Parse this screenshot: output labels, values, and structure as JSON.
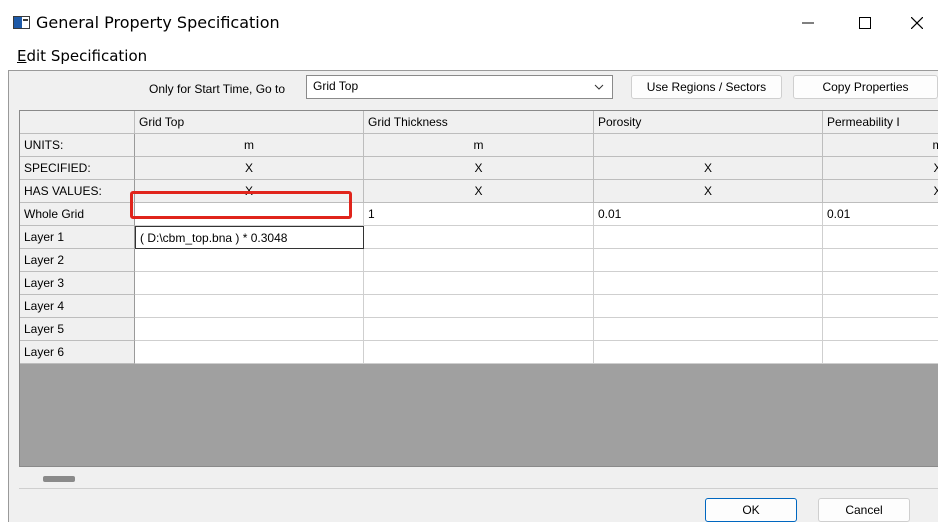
{
  "window": {
    "title": "General Property Specification",
    "minimize_glyph": "—",
    "close_glyph": "✕"
  },
  "menu": {
    "edit_first": "E",
    "edit_rest": "dit Specification"
  },
  "toolbar": {
    "goto_label": "Only for Start Time, Go to",
    "goto_selected": "Grid Top",
    "use_regions_label": "Use Regions / Sectors",
    "copy_properties_label": "Copy Properties"
  },
  "grid": {
    "columns": [
      "Grid Top",
      "Grid Thickness",
      "Porosity",
      "Permeability I"
    ],
    "units_label": "UNITS:",
    "units": [
      "m",
      "m",
      "",
      "m"
    ],
    "specified_label": "SPECIFIED:",
    "specified": [
      "X",
      "X",
      "X",
      "X"
    ],
    "has_values_label": "HAS VALUES:",
    "has_values": [
      "X",
      "X",
      "X",
      "X"
    ],
    "whole_grid_label": "Whole Grid",
    "whole_grid": [
      "",
      "1",
      "0.01",
      "0.01"
    ],
    "layers": [
      {
        "label": "Layer 1",
        "values": [
          "( D:\\cbm_top.bna ) * 0.3048",
          "",
          "",
          ""
        ]
      },
      {
        "label": "Layer 2",
        "values": [
          "",
          "",
          "",
          ""
        ]
      },
      {
        "label": "Layer 3",
        "values": [
          "",
          "",
          "",
          ""
        ]
      },
      {
        "label": "Layer 4",
        "values": [
          "",
          "",
          "",
          ""
        ]
      },
      {
        "label": "Layer 5",
        "values": [
          "",
          "",
          "",
          ""
        ]
      },
      {
        "label": "Layer 6",
        "values": [
          "",
          "",
          "",
          ""
        ]
      }
    ]
  },
  "dialog_buttons": {
    "ok": "OK",
    "cancel": "Cancel"
  },
  "colors": {
    "highlight": "#e0241b",
    "grid_background": "#a0a0a0",
    "ok_border": "#0067c0"
  }
}
